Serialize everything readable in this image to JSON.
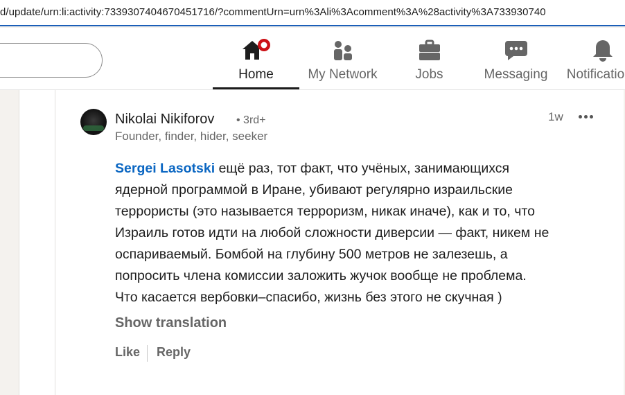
{
  "browser": {
    "url": "d/update/urn:li:activity:7339307404670451716/?commentUrn=urn%3Ali%3Acomment%3A%28activity%3A733930740"
  },
  "nav": {
    "items": [
      {
        "label": "Home",
        "icon": "home-icon"
      },
      {
        "label": "My Network",
        "icon": "network-icon"
      },
      {
        "label": "Jobs",
        "icon": "briefcase-icon"
      },
      {
        "label": "Messaging",
        "icon": "message-icon"
      },
      {
        "label": "Notifications",
        "icon": "bell-icon"
      }
    ]
  },
  "comment": {
    "author": "Nikolai Nikiforov",
    "degree": "• 3rd+",
    "headline": "Founder, finder, hider, seeker",
    "time": "1w",
    "mention": "Sergei Lasotski",
    "lines": [
      " ещё раз, тот факт, что учёных, занимающихся",
      "ядерной программой в Иране, убивают регулярно израильские",
      "террористы (это называется терроризм, никак иначе), как и то, что",
      "Израиль готов идти на любой сложности диверсии — факт, никем не",
      "оспариваемый. Бомбой на глубину 500 метров не залезешь, а",
      "попросить члена комиссии заложить жучок вообще не проблема.",
      "Что касается вербовки–спасибо, жизнь без этого не скучная )"
    ],
    "show_translation": "Show translation",
    "actions": {
      "like": "Like",
      "reply": "Reply"
    }
  },
  "colors": {
    "accent": "#0a66c2",
    "notification_badge": "#cc1016",
    "url_underline": "#1b5fb8"
  }
}
